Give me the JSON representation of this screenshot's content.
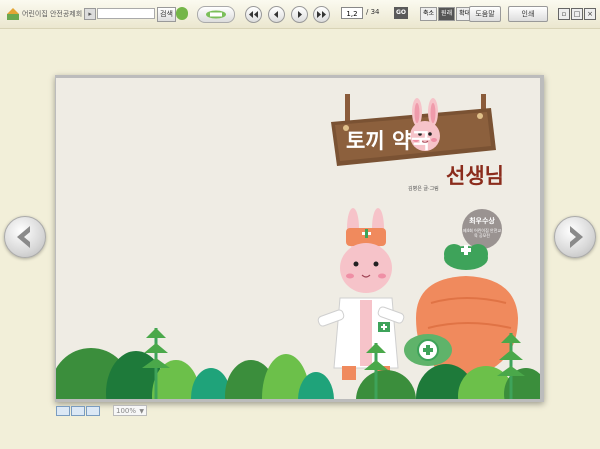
{
  "toolbar": {
    "logo_text": "어린이집 안전공제회",
    "search_placeholder": "",
    "search_label": "검색",
    "page_current": "1,2",
    "page_total": "/ 34",
    "go_label": "GO",
    "zoom_out_label": "축소",
    "zoom_fit_label": "원래",
    "zoom_in_label": "확대",
    "toc_label": "도움말",
    "print_label": "인쇄",
    "icons": {
      "first": "first-page-icon",
      "prev": "prev-page-icon",
      "next": "next-page-icon",
      "last": "last-page-icon"
    }
  },
  "cover": {
    "title": "토끼 약국",
    "subtitle": "선생님",
    "author": "김병은 글·그림",
    "award_main": "최우수상",
    "award_sub": "제4회 어린이집 안전교육 공모전"
  },
  "status": {
    "zoom": "100%"
  },
  "colors": {
    "sign_wood": "#7a5233",
    "subtitle": "#8b2c1c",
    "carrot": "#f08a5d",
    "leaf_green": "#4aa84a"
  }
}
